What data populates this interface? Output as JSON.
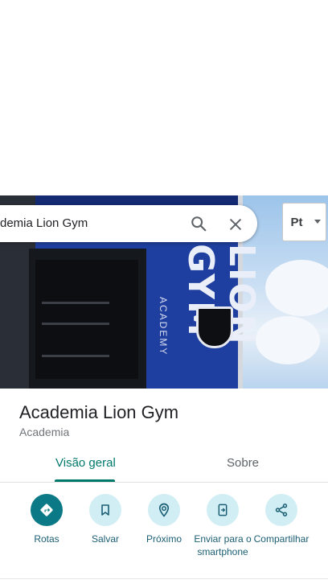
{
  "search": {
    "query": "demia Lion Gym"
  },
  "layer_button": {
    "label": "Pt"
  },
  "place": {
    "name": "Academia Lion Gym",
    "category": "Academia"
  },
  "tabs": [
    {
      "label": "Visão geral",
      "active": true
    },
    {
      "label": "Sobre",
      "active": false
    }
  ],
  "actions": [
    {
      "label": "Rotas",
      "icon": "directions-icon"
    },
    {
      "label": "Salvar",
      "icon": "bookmark-icon"
    },
    {
      "label": "Próximo",
      "icon": "nearby-icon"
    },
    {
      "label": "Enviar para o smartphone",
      "icon": "send-to-phone-icon"
    },
    {
      "label": "Compartilhar",
      "icon": "share-icon"
    }
  ],
  "colors": {
    "accent": "#00796b",
    "primary_action": "#0b7a86",
    "action_bg": "#d2eef5",
    "label": "#1a5e73"
  }
}
